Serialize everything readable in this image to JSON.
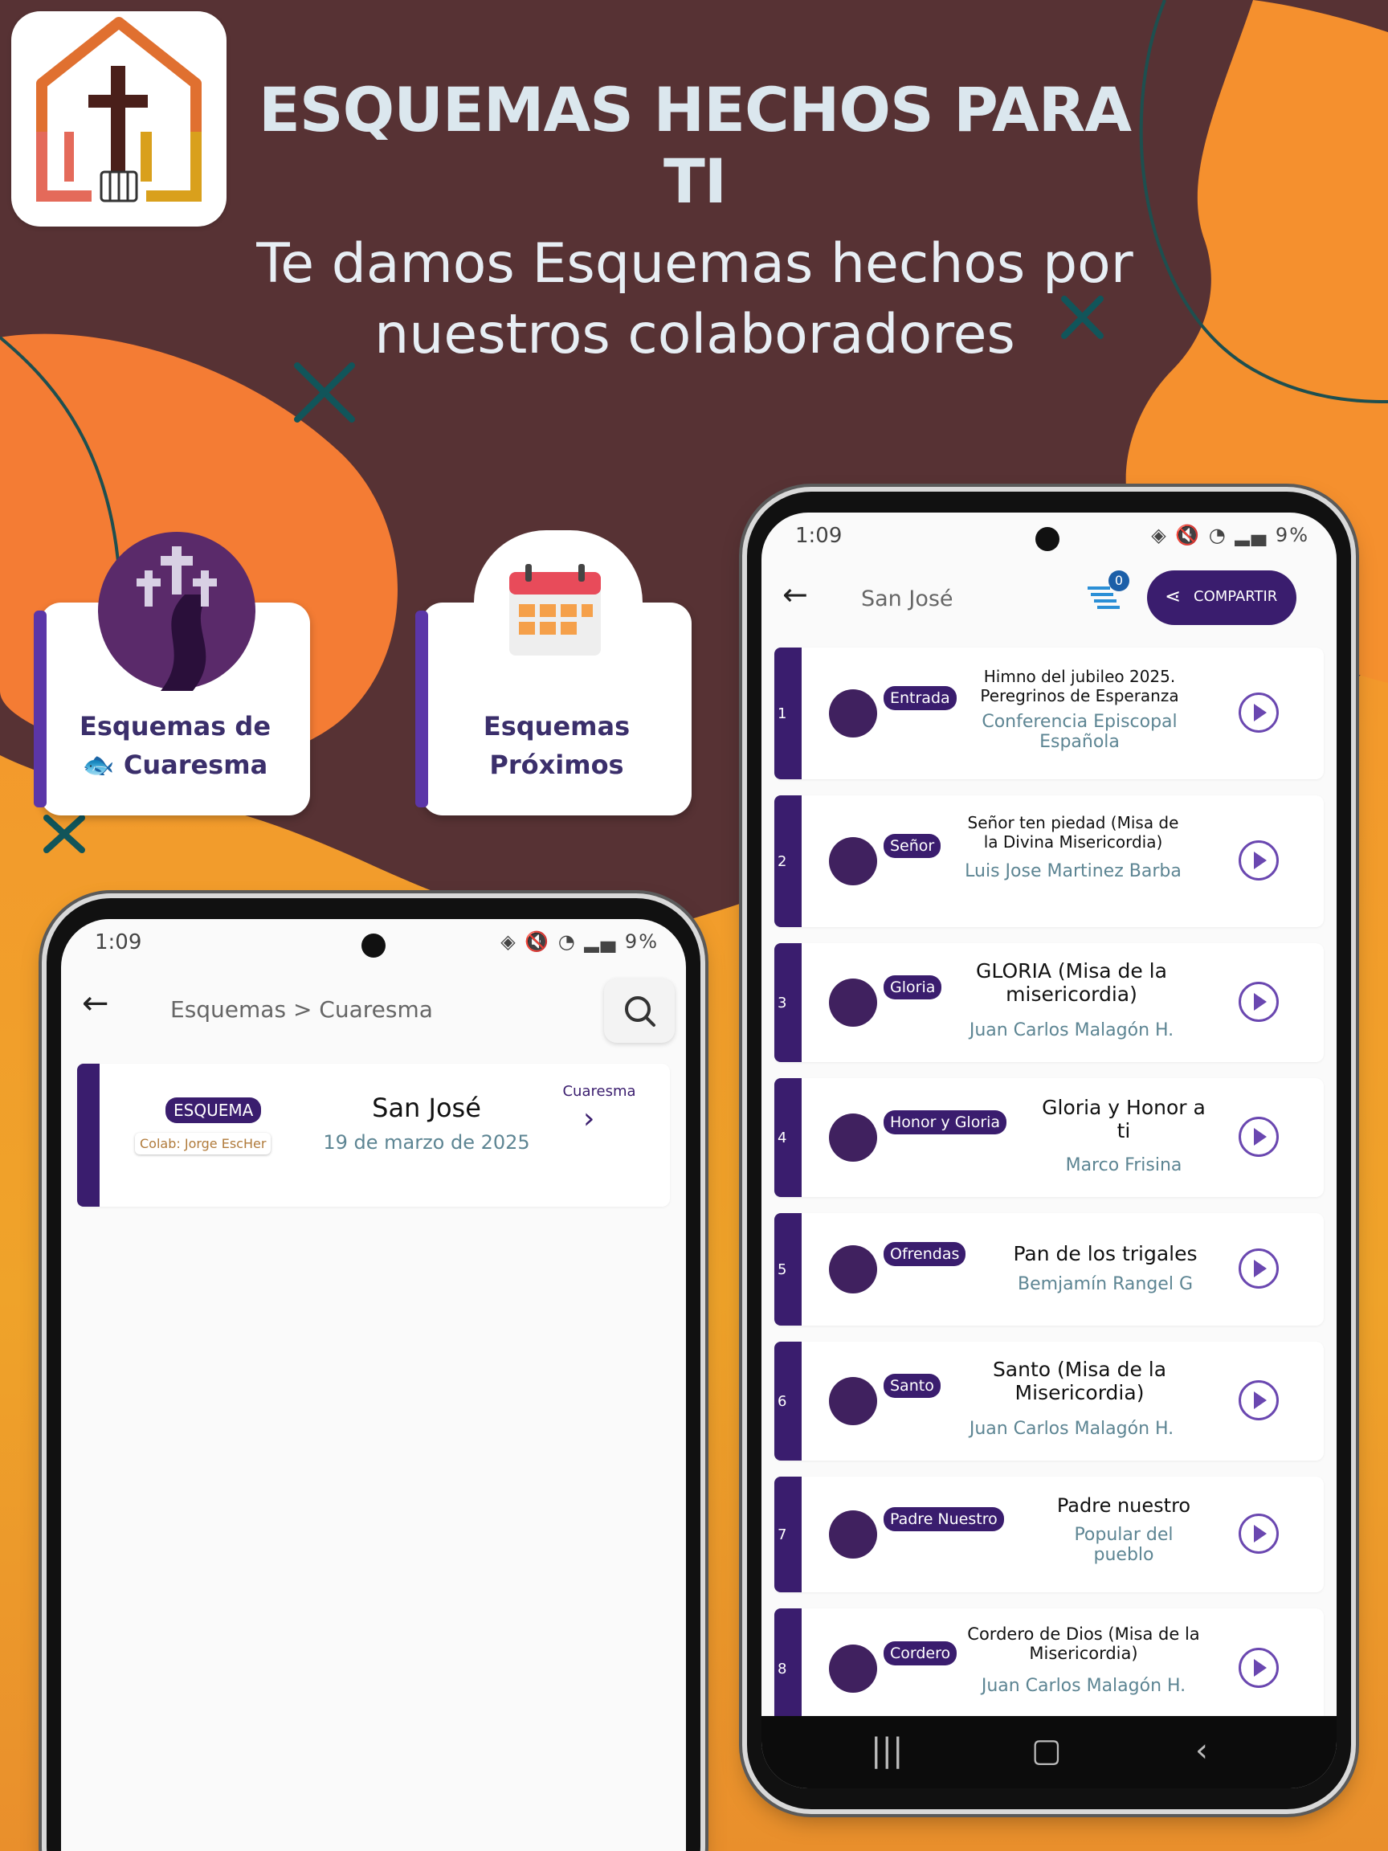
{
  "headline": "ESQUEMAS HECHOS PARA TI",
  "subheadline_line1": "Te damos Esquemas hechos por",
  "subheadline_line2": "nuestros colaboradores",
  "categories": [
    {
      "line1": "Esquemas de",
      "line2": "Cuaresma",
      "icon": "crosses-path-icon"
    },
    {
      "line1": "Esquemas",
      "line2": "Próximos",
      "icon": "calendar-icon"
    }
  ],
  "left_phone": {
    "time": "1:09",
    "battery": "9%",
    "breadcrumb": "Esquemas > Cuaresma",
    "card": {
      "badge": "ESQUEMA",
      "colab": "Colab: Jorge EscHer",
      "title": "San José",
      "date": "19 de marzo de 2025",
      "category": "Cuaresma"
    }
  },
  "right_phone": {
    "time": "1:09",
    "battery": "9%",
    "title": "San José",
    "counter": "0",
    "share_label": "COMPARTIR",
    "songs": [
      {
        "n": "1",
        "tag": "Entrada",
        "title": "Himno del jubileo 2025. Peregrinos de Esperanza",
        "author": "Conferencia Episcopal Española"
      },
      {
        "n": "2",
        "tag": "Señor",
        "title": "Señor ten piedad (Misa de la Divina Misericordia)",
        "author": "Luis Jose Martinez Barba"
      },
      {
        "n": "3",
        "tag": "Gloria",
        "title": "GLORIA (Misa de la misericordia)",
        "author": "Juan Carlos Malagón H."
      },
      {
        "n": "4",
        "tag": "Honor y Gloria",
        "title": "Gloria y Honor a ti",
        "author": "Marco Frisina"
      },
      {
        "n": "5",
        "tag": "Ofrendas",
        "title": "Pan de los trigales",
        "author": "Bemjamín Rangel G"
      },
      {
        "n": "6",
        "tag": "Santo",
        "title": "Santo (Misa de la Misericordia)",
        "author": "Juan Carlos Malagón H."
      },
      {
        "n": "7",
        "tag": "Padre Nuestro",
        "title": "Padre nuestro",
        "author": "Popular del pueblo"
      },
      {
        "n": "8",
        "tag": "Cordero",
        "title": "Cordero de Dios (Misa de la Misericordia)",
        "author": "Juan Carlos Malagón H."
      }
    ]
  },
  "colors": {
    "dark_brown": "#573234",
    "accent_purple": "#3a1d6e",
    "teal_text": "#5d8593"
  }
}
